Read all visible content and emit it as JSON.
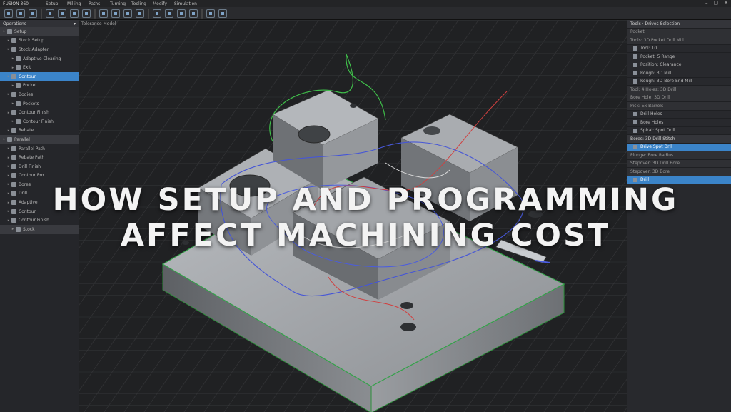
{
  "app": {
    "title": "FUSION 360",
    "menu": [
      "Setup",
      "Milling",
      "Paths",
      "Turning",
      "Tooling",
      "Modify",
      "Simulation"
    ],
    "window_controls": [
      "–",
      "▢",
      "✕"
    ]
  },
  "browser": {
    "header": "Operations",
    "items": [
      {
        "label": "Setup",
        "level": 0,
        "group": true
      },
      {
        "label": "Stock Setup",
        "level": 1
      },
      {
        "label": "Stock Adapter",
        "level": 1
      },
      {
        "label": "Adaptive Clearing",
        "level": 2
      },
      {
        "label": "Exit",
        "level": 2
      },
      {
        "label": "Contour",
        "level": 1,
        "selected": true
      },
      {
        "label": "Pocket",
        "level": 2
      },
      {
        "label": "Bodies",
        "level": 1
      },
      {
        "label": "Pockets",
        "level": 2
      },
      {
        "label": "Contour Finish",
        "level": 1
      },
      {
        "label": "Contour Finish",
        "level": 2
      },
      {
        "label": "Rebate",
        "level": 1
      },
      {
        "label": "Parallel",
        "level": 0,
        "group": true
      },
      {
        "label": "Parallel Path",
        "level": 1
      },
      {
        "label": "Rebate Path",
        "level": 1
      },
      {
        "label": "Drill Finish",
        "level": 1
      },
      {
        "label": "Contour Pro",
        "level": 1
      },
      {
        "label": "Bores",
        "level": 1
      },
      {
        "label": "Drill",
        "level": 1
      },
      {
        "label": "Adaptive",
        "level": 1
      },
      {
        "label": "Contour",
        "level": 1
      },
      {
        "label": "Contour Finish",
        "level": 1
      },
      {
        "label": "Stock",
        "level": 2,
        "group": true
      }
    ]
  },
  "viewport": {
    "label": "Tolerance Model"
  },
  "inspector": {
    "header": "Tools · Drives Selection",
    "rows": [
      {
        "label": "Pocket",
        "type": "sub"
      },
      {
        "label": "Tools: 3D Pocket Drill Mill",
        "type": "sub"
      },
      {
        "label": "Tool: 10",
        "type": "item"
      },
      {
        "label": "Pocket: 5 Range",
        "type": "item"
      },
      {
        "label": "Position: Clearance",
        "type": "item"
      },
      {
        "label": "Rough: 3D Mill",
        "type": "item"
      },
      {
        "label": "Rough: 3D Bore End Mill",
        "type": "item"
      },
      {
        "label": "Tool: 4 Holes: 3D Drill",
        "type": "sub"
      },
      {
        "label": "Bore Hole: 3D Drill",
        "type": "sub"
      },
      {
        "label": "Pick: Ex Barrels",
        "type": "sub"
      },
      {
        "label": "Drill Holes",
        "type": "item"
      },
      {
        "label": "Bore Holes",
        "type": "item"
      },
      {
        "label": "Spiral: Spot Drill",
        "type": "item"
      },
      {
        "label": "Bores: 3D Drill Stitch",
        "type": "head"
      },
      {
        "label": "Drive Spot Drill",
        "type": "selected"
      },
      {
        "label": "Plunge: Bore Radius",
        "type": "sub"
      },
      {
        "label": "Stepover: 3D Drill Bore",
        "type": "sub"
      },
      {
        "label": "Stepover: 3D Bore",
        "type": "sub"
      },
      {
        "label": "Drill",
        "type": "selected"
      }
    ]
  },
  "headline": {
    "line1": "HOW SETUP AND PROGRAMMING",
    "line2": "AFFECT MACHINING COST"
  }
}
